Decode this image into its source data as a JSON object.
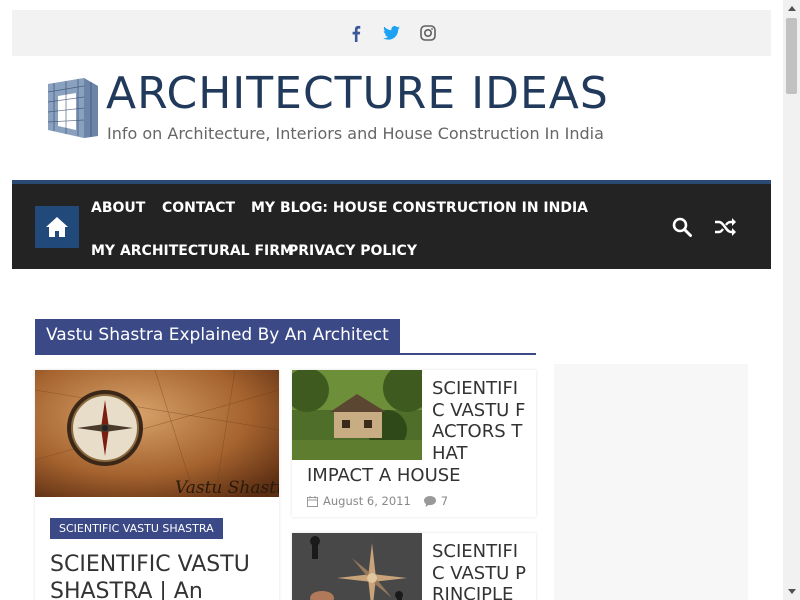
{
  "social": {
    "icons": [
      "facebook-icon",
      "twitter-icon",
      "instagram-icon"
    ],
    "colors": {
      "facebook": "#3b5998",
      "twitter": "#1da1f2",
      "instagram": "#5f5f5f"
    }
  },
  "site": {
    "title": "ARCHITECTURE IDEAS",
    "tagline": "Info on Architecture, Interiors and House Construction In India",
    "title_color": "#213a5c"
  },
  "nav": {
    "items": [
      "ABOUT",
      "CONTACT",
      "MY BLOG: HOUSE CONSTRUCTION IN INDIA",
      "MY ARCHITECTURAL FIRM",
      "PRIVACY POLICY"
    ],
    "icons": [
      "home-icon",
      "search-icon",
      "shuffle-icon"
    ],
    "background": "#232323",
    "accent": "#214a7a"
  },
  "section": {
    "heading": "Vastu Shastra Explained By An Architect",
    "accent": "#3b4a86"
  },
  "posts": {
    "featured": {
      "category": "SCIENTIFIC VASTU SHASTRA",
      "title": "SCIENTIFIC VASTU SHASTRA | An",
      "image_text": "Vastu Shastra"
    },
    "small": [
      {
        "title_right": "SCIENTIFIC VASTU FACTORS THAT",
        "title_full": "IMPACT A HOUSE",
        "date": "August 6, 2011",
        "comments": "7"
      },
      {
        "title_right": "SCIENTIFIC VASTU PRINCIPLE"
      }
    ]
  }
}
